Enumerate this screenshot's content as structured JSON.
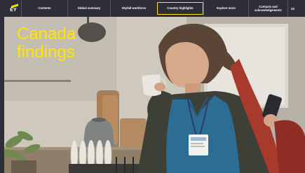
{
  "brand": {
    "logo_text": "EY",
    "accent_color": "#ffe600",
    "nav_bg": "#2e2e38"
  },
  "nav": {
    "items": [
      {
        "label": "Contents",
        "active": false
      },
      {
        "label": "Global summary",
        "active": false
      },
      {
        "label": "Skyfall workforce",
        "active": false
      },
      {
        "label": "Country highlights",
        "active": true
      },
      {
        "label": "Explore more",
        "active": false
      },
      {
        "label": "Contacts and\nacknowledgements",
        "active": false
      }
    ],
    "page_number": "22"
  },
  "hero": {
    "title": "Canada\nfindings",
    "title_color": "#ffe600",
    "image_description_icon": "photo-nurse-drinking-coffee"
  }
}
